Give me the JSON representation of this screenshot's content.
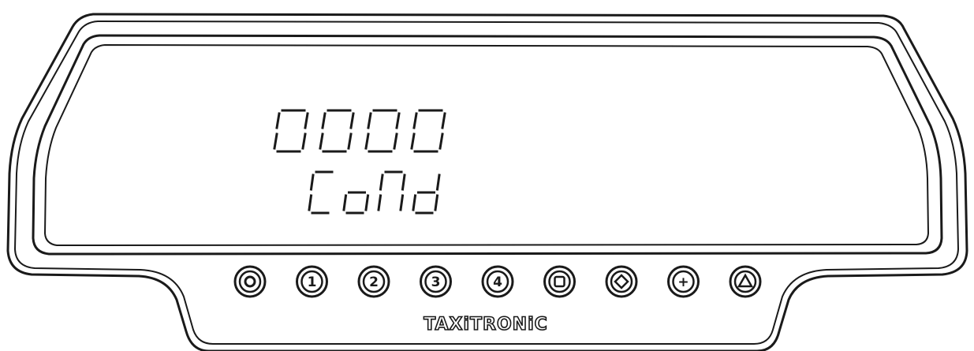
{
  "display": {
    "line1": "0000",
    "line2": "CoNd"
  },
  "buttons": [
    {
      "id": "0",
      "label": "O",
      "icon": "circle-icon"
    },
    {
      "id": "1",
      "label": "1",
      "icon": "digit-1-icon"
    },
    {
      "id": "2",
      "label": "2",
      "icon": "digit-2-icon"
    },
    {
      "id": "3",
      "label": "3",
      "icon": "digit-3-icon"
    },
    {
      "id": "4",
      "label": "4",
      "icon": "digit-4-icon"
    },
    {
      "id": "square",
      "label": "",
      "icon": "square-icon"
    },
    {
      "id": "diamond",
      "label": "",
      "icon": "diamond-icon"
    },
    {
      "id": "plus",
      "label": "+",
      "icon": "plus-icon"
    },
    {
      "id": "triangle",
      "label": "",
      "icon": "triangle-icon"
    }
  ],
  "brand": "TAXiTRONiC",
  "colors": {
    "ink": "#1a1a1a",
    "paper": "#ffffff"
  }
}
